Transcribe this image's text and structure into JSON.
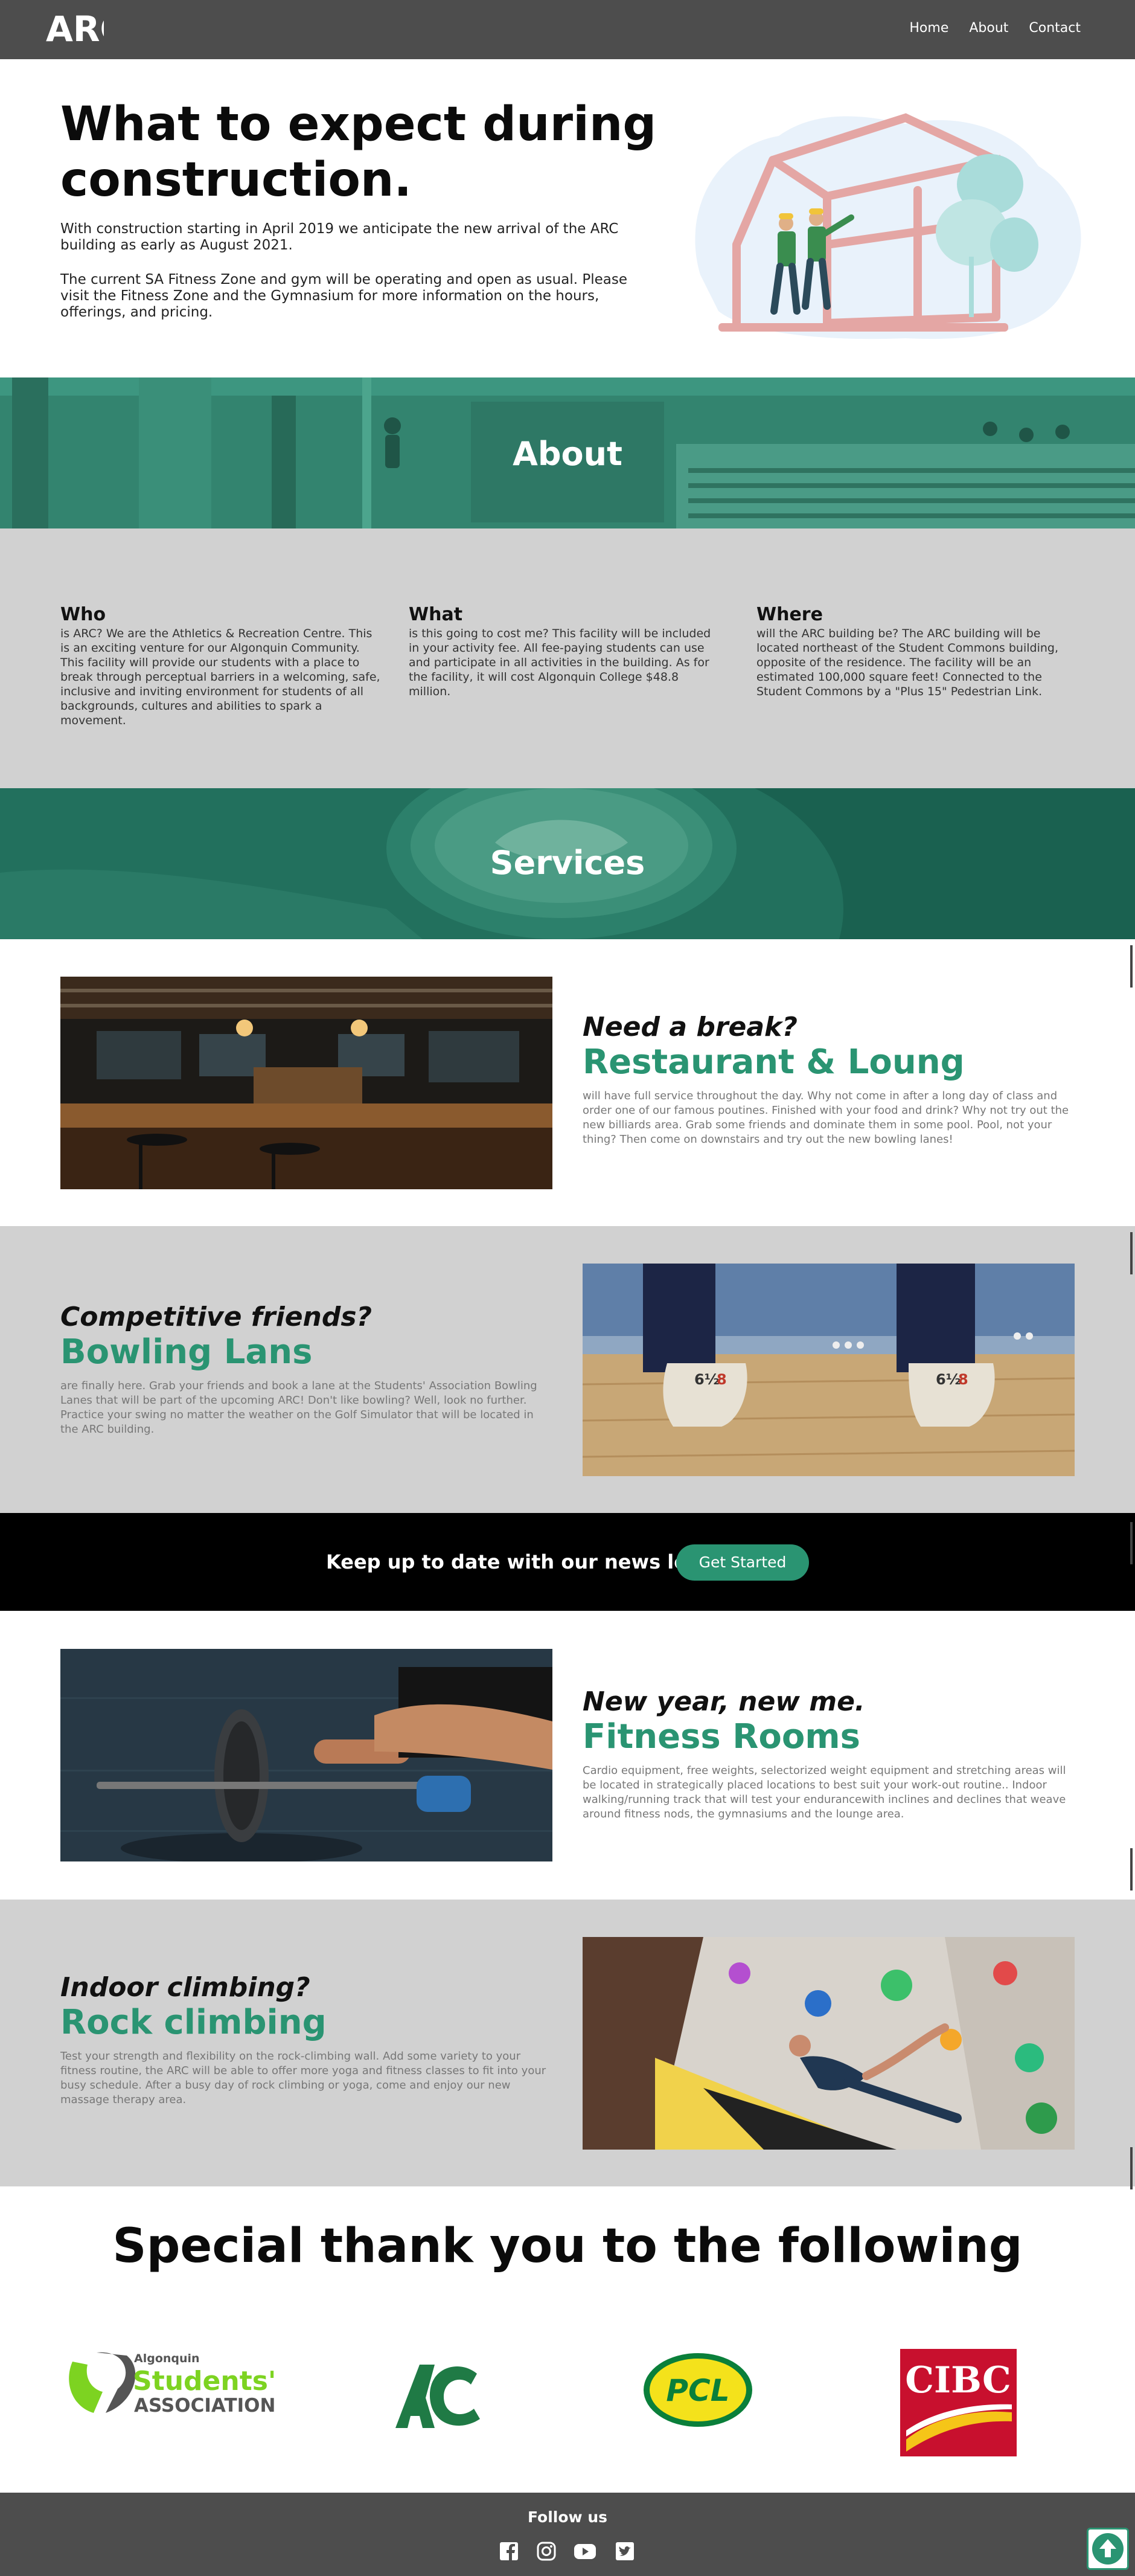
{
  "nav": {
    "logo_text": "ARC",
    "links": [
      "Home",
      "About",
      "Contact"
    ]
  },
  "hero": {
    "title": "What to expect during construction.",
    "p1": "With construction starting in April 2019 we anticipate the new arrival of the ARC building as early as August 2021.",
    "p2": "The current SA Fitness Zone and gym will be operating and open as usual. Please visit the Fitness Zone and the Gymnasium for more information on the hours, offerings, and pricing."
  },
  "about_banner": {
    "title": "About"
  },
  "about": {
    "who": {
      "heading": "Who",
      "text": "is ARC? We are the Athletics & Recreation Centre. This is an exciting venture for our Algonquin Community. This facility will provide our students with a place to break through perceptual barriers in a welcoming, safe, inclusive and inviting environment for students of all backgrounds, cultures and abilities to spark a movement."
    },
    "what": {
      "heading": "What",
      "text": "is this going to cost me? This facility will be included in your activity fee. All fee-paying students can use and participate in all activities in the building. As for the facility, it will cost Algonquin College $48.8 million."
    },
    "where": {
      "heading": "Where",
      "text": "will the ARC building be? The ARC building will be located northeast of the Student Commons building, opposite of the residence. The facility will be an estimated 100,000 square feet! Connected to the Student Commons by a \"Plus 15\" Pedestrian Link."
    }
  },
  "services_banner": {
    "title": "Services"
  },
  "services": [
    {
      "kicker": "Need a break?",
      "title": "Restaurant & Loung",
      "desc": "will have full service throughout the day. Why not come in after a long day of class and order one of our famous poutines. Finished with your food and drink? Why not try out the new billiards area. Grab some friends and dominate them in some pool. Pool, not your thing? Then come on downstairs and try out the new bowling lanes!"
    },
    {
      "kicker": "Competitive friends?",
      "title": "Bowling Lans",
      "desc": "are finally here. Grab your friends and book a lane at the Students' Association Bowling Lanes that will be part of the upcoming ARC! Don't like bowling? Well, look no further. Practice your swing no matter the weather on the Golf Simulator that will be located in the ARC building."
    },
    {
      "kicker": "New year, new me.",
      "title": "Fitness Rooms",
      "desc": "Cardio equipment, free weights, selectorized weight equipment and stretching areas will be located in strategically placed locations to best suit your work-out routine.. Indoor walking/running track that will test your endurancewith inclines and declines that weave around fitness nods, the gymnasiums and the lounge area."
    },
    {
      "kicker": "Indoor climbing?",
      "title": "Rock climbing",
      "desc": "Test your strength and flexibility on the rock-climbing wall. Add some variety to your fitness routine, the ARC will be able to offer more yoga and fitness classes to fit into your busy schedule. After a busy day of rock climbing or yoga, come and enjoy our new massage therapy area."
    }
  ],
  "newsletter": {
    "text": "Keep up to date with our news letter",
    "button": "Get Started"
  },
  "thanks": {
    "title": "Special thank you to the following",
    "sponsors": [
      {
        "top": "Algonquin",
        "mid": "Students'",
        "bottom": "ASSOCIATION"
      },
      {
        "text": "AC"
      },
      {
        "text": "PCL"
      },
      {
        "text": "CIBC"
      }
    ]
  },
  "footer": {
    "title": "Follow us",
    "icons": [
      "facebook-icon",
      "instagram-icon",
      "youtube-icon",
      "twitter-icon"
    ]
  },
  "colors": {
    "accent": "#2a9472",
    "nav_bg": "#4d4d4d",
    "section_gray": "#d1d1d1"
  }
}
